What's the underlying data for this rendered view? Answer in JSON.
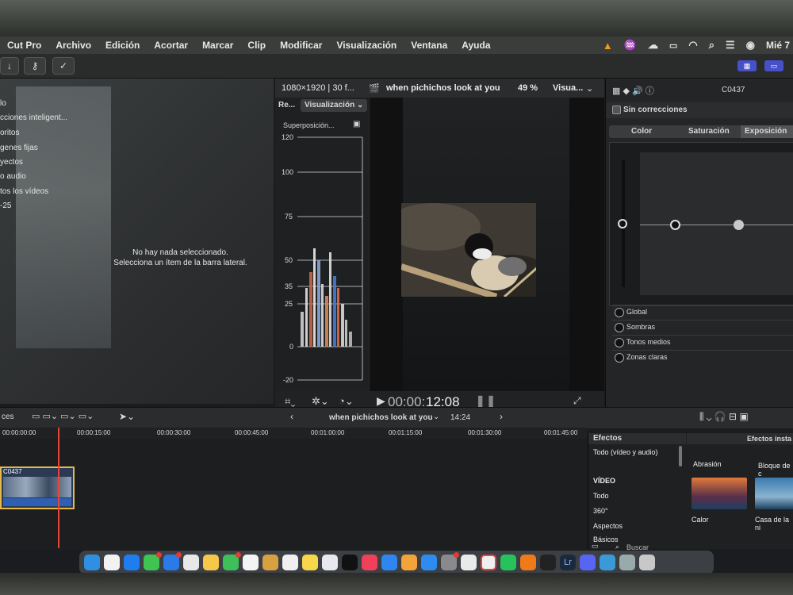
{
  "menubar": {
    "app": "Cut Pro",
    "items": [
      "Archivo",
      "Edición",
      "Acortar",
      "Marcar",
      "Clip",
      "Modificar",
      "Visualización",
      "Ventana",
      "Ayuda"
    ],
    "clock": "Mié 7"
  },
  "sidebar": {
    "items": [
      "lo",
      "cciones inteligent...",
      "oritos",
      "genes fijas",
      "yectos",
      "o audio",
      "tos los vídeos",
      "-25"
    ]
  },
  "browser": {
    "empty_line1": "No hay nada seleccionado.",
    "empty_line2": "Selecciona un ítem de la barra lateral."
  },
  "viewer": {
    "format": "1080×1920 | 30 f...",
    "project": "when pichichos look at you",
    "zoom": "49 %",
    "view_menu": "Visua...",
    "timecode_prefix": "00:00:",
    "timecode_main": "12:08"
  },
  "scopes": {
    "tab": "Re...",
    "mode": "Visualización",
    "overlay": "Superposición...",
    "ticks": [
      "120",
      "100",
      "75",
      "50",
      "35",
      "25",
      "0",
      "-20"
    ]
  },
  "inspector": {
    "clip_name": "C0437",
    "corrections": "Sin correcciones",
    "tabs": [
      "Color",
      "Saturación",
      "Exposición"
    ],
    "active_tab": "Exposición",
    "wheels": [
      "Global",
      "Sombras",
      "Tonos medios",
      "Zonas claras"
    ]
  },
  "timeline": {
    "index": "ces",
    "project": "when pichichos look at you",
    "duration": "14:24",
    "ruler": [
      "00:00:00:00",
      "00:00:15:00",
      "00:00:30:00",
      "00:00:45:00",
      "00:01:00:00",
      "00:01:15:00",
      "00:01:30:00",
      "00:01:45:00"
    ],
    "clip_name": "C0437"
  },
  "effects": {
    "title": "Efectos",
    "installed_title": "Efectos insta",
    "categories": [
      "Todo (vídeo y audio)",
      "VÍDEO",
      "Todo",
      "360°",
      "Aspectos",
      "Básicos"
    ],
    "thumbs": [
      "Abrasión",
      "Bloque de c",
      "Calor",
      "Casa de la ni"
    ],
    "search_placeholder": "Buscar"
  },
  "colors": {
    "accent_blue": "#4750c9",
    "playhead": "#e8453c",
    "clip_border": "#e6b84a"
  }
}
